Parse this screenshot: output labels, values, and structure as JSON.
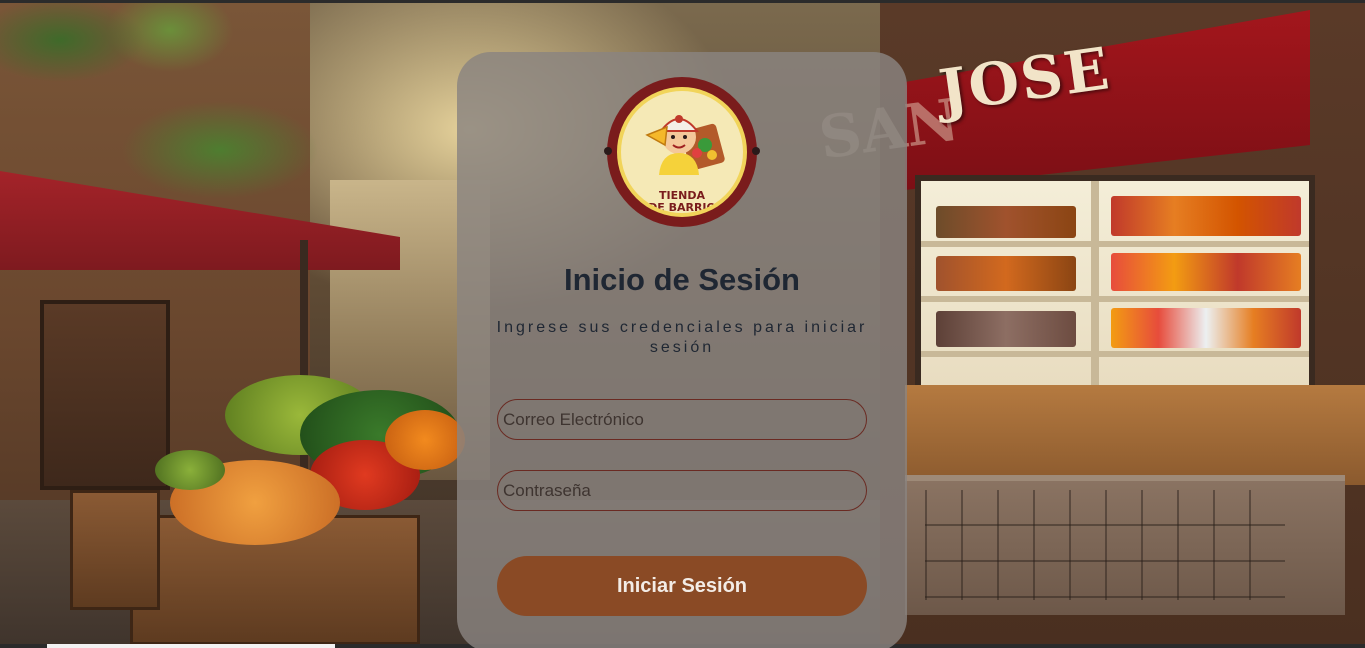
{
  "background": {
    "shop_sign": "JOSE",
    "shop_sign_ghost": "SAN"
  },
  "logo": {
    "line1": "TIENDA",
    "line2": "DE BARRIO"
  },
  "login": {
    "title": "Inicio de Sesión",
    "subtitle": "Ingrese sus credenciales para iniciar sesión",
    "email_placeholder": "Correo Electrónico",
    "password_placeholder": "Contraseña",
    "submit_label": "Iniciar Sesión"
  },
  "colors": {
    "button": "#8a4a25",
    "title": "#1f2733",
    "field_border": "#6a2a22",
    "logo_ring": "#7a1c1c"
  }
}
